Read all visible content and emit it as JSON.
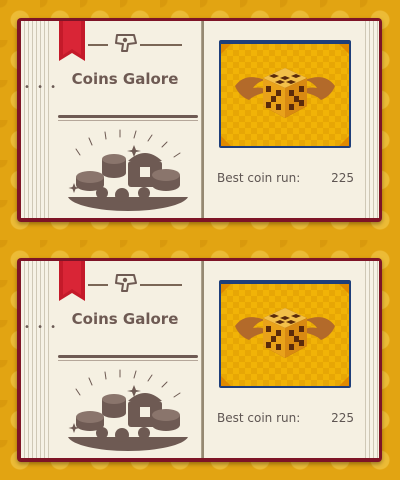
{
  "screens": [
    {
      "title": "Coins Galore",
      "stat_label": "Best coin run:",
      "stat_value": "225",
      "icons": {
        "bookmark": "red-ribbon-bookmark-icon",
        "header": "level-badge-icon",
        "illustration": "coin-treasure-pile-icon",
        "preview": "winged-dice-block-icon"
      }
    },
    {
      "title": "Coins Galore",
      "stat_label": "Best coin run:",
      "stat_value": "225",
      "icons": {
        "bookmark": "red-ribbon-bookmark-icon",
        "header": "level-badge-icon",
        "illustration": "coin-treasure-pile-icon",
        "preview": "winged-dice-block-icon"
      }
    }
  ],
  "colors": {
    "background": "#e2a412",
    "book_cover": "#7e1426",
    "page": "#f5f0e2",
    "ink": "#6e5a53",
    "preview_frame": "#1e3e7a",
    "preview_fill": "#f1b307"
  }
}
